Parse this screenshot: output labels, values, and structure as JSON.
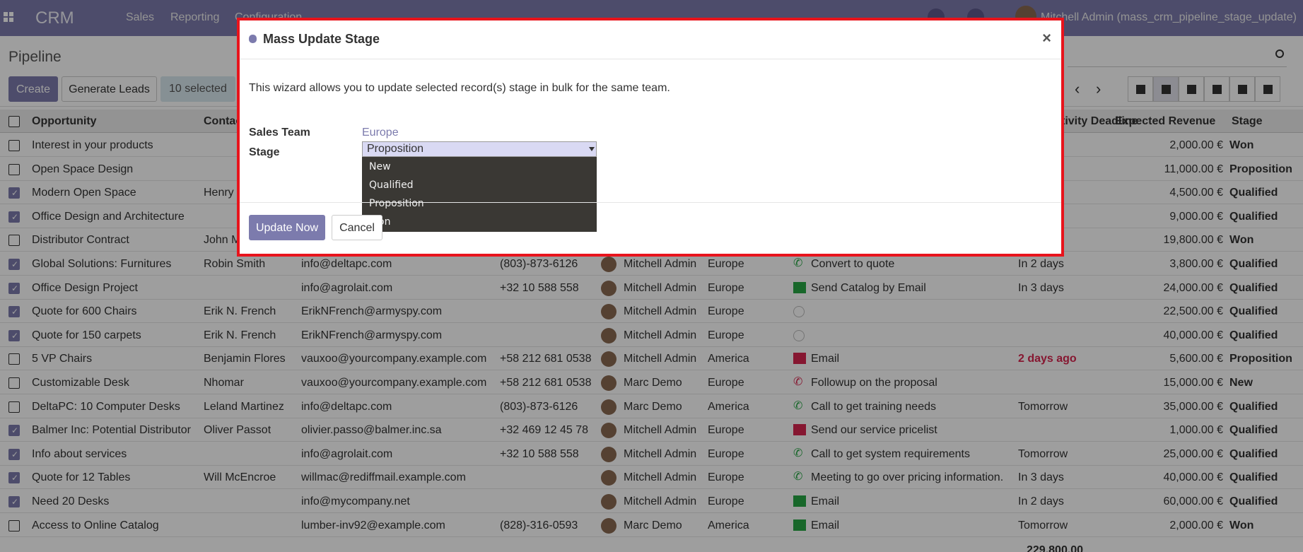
{
  "topbar": {
    "brand": "CRM",
    "menu": [
      "Sales",
      "Reporting",
      "Configuration"
    ],
    "user": "Mitchell Admin (mass_crm_pipeline_stage_update)"
  },
  "control_panel": {
    "breadcrumb": "Pipeline",
    "create_label": "Create",
    "generate_label": "Generate Leads",
    "selected_label": "10 selected"
  },
  "grid": {
    "headers": {
      "opportunity": "Opportunity",
      "contact": "Contact Name",
      "pipeline": "Next Activity Deadline",
      "revenue": "Expected Revenue",
      "stage": "Stage"
    },
    "rows": [
      {
        "checked": false,
        "opportunity": "Interest in your products",
        "contact": "",
        "email": "",
        "phone": "",
        "user": "",
        "team": "",
        "activity": "",
        "activity_type": "",
        "deadline": "",
        "revenue": "2,000.00 €",
        "stage": "Won"
      },
      {
        "checked": false,
        "opportunity": "Open Space Design",
        "contact": "",
        "email": "",
        "phone": "",
        "user": "",
        "team": "",
        "activity": "",
        "activity_type": "",
        "deadline": "",
        "revenue": "11,000.00 €",
        "stage": "Proposition"
      },
      {
        "checked": true,
        "opportunity": "Modern Open Space",
        "contact": "Henry",
        "email": "",
        "phone": "",
        "user": "",
        "team": "",
        "activity": "",
        "activity_type": "",
        "deadline": "",
        "revenue": "4,500.00 €",
        "stage": "Qualified"
      },
      {
        "checked": true,
        "opportunity": "Office Design and Architecture",
        "contact": "",
        "email": "",
        "phone": "",
        "user": "",
        "team": "",
        "activity": "",
        "activity_type": "",
        "deadline": "",
        "revenue": "9,000.00 €",
        "stage": "Qualified"
      },
      {
        "checked": false,
        "opportunity": "Distributor Contract",
        "contact": "John M",
        "email": "",
        "phone": "",
        "user": "",
        "team": "",
        "activity": "",
        "activity_type": "",
        "deadline": "",
        "revenue": "19,800.00 €",
        "stage": "Won"
      },
      {
        "checked": true,
        "opportunity": "Global Solutions: Furnitures",
        "contact": "Robin Smith",
        "email": "info@deltapc.com",
        "phone": "(803)-873-6126",
        "user": "Mitchell Admin",
        "team": "Europe",
        "activity": "Convert to quote",
        "activity_type": "phone",
        "deadline": "In 2 days",
        "revenue": "3,800.00 €",
        "stage": "Qualified"
      },
      {
        "checked": true,
        "opportunity": "Office Design Project",
        "contact": "",
        "email": "info@agrolait.com",
        "phone": "+32 10 588 558",
        "user": "Mitchell Admin",
        "team": "Europe",
        "activity": "Send Catalog by Email",
        "activity_type": "mail",
        "deadline": "In 3 days",
        "revenue": "24,000.00 €",
        "stage": "Qualified"
      },
      {
        "checked": true,
        "opportunity": "Quote for 600 Chairs",
        "contact": "Erik N. French",
        "email": "ErikNFrench@armyspy.com",
        "phone": "",
        "user": "Mitchell Admin",
        "team": "Europe",
        "activity": "",
        "activity_type": "clock",
        "deadline": "",
        "revenue": "22,500.00 €",
        "stage": "Qualified"
      },
      {
        "checked": true,
        "opportunity": "Quote for 150 carpets",
        "contact": "Erik N. French",
        "email": "ErikNFrench@armyspy.com",
        "phone": "",
        "user": "Mitchell Admin",
        "team": "Europe",
        "activity": "",
        "activity_type": "clock",
        "deadline": "",
        "revenue": "40,000.00 €",
        "stage": "Qualified"
      },
      {
        "checked": false,
        "opportunity": "5 VP Chairs",
        "contact": "Benjamin Flores",
        "email": "vauxoo@yourcompany.example.com",
        "phone": "+58 212 681 0538",
        "user": "Mitchell Admin",
        "team": "America",
        "activity": "Email",
        "activity_type": "mail-red",
        "deadline": "2 days ago",
        "revenue": "5,600.00 €",
        "stage": "Proposition"
      },
      {
        "checked": false,
        "opportunity": "Customizable Desk",
        "contact": "Nhomar",
        "email": "vauxoo@yourcompany.example.com",
        "phone": "+58 212 681 0538",
        "user": "Marc Demo",
        "team": "Europe",
        "activity": "Followup on the proposal",
        "activity_type": "phone-red",
        "deadline": "",
        "revenue": "15,000.00 €",
        "stage": "New"
      },
      {
        "checked": false,
        "opportunity": "DeltaPC: 10 Computer Desks",
        "contact": "Leland Martinez",
        "email": "info@deltapc.com",
        "phone": "(803)-873-6126",
        "user": "Marc Demo",
        "team": "America",
        "activity": "Call to get training needs",
        "activity_type": "phone",
        "deadline": "Tomorrow",
        "revenue": "35,000.00 €",
        "stage": "Qualified"
      },
      {
        "checked": true,
        "opportunity": "Balmer Inc: Potential Distributor",
        "contact": "Oliver Passot",
        "email": "olivier.passo@balmer.inc.sa",
        "phone": "+32 469 12 45 78",
        "user": "Mitchell Admin",
        "team": "Europe",
        "activity": "Send our service pricelist",
        "activity_type": "mail-red",
        "deadline": "",
        "revenue": "1,000.00 €",
        "stage": "Qualified"
      },
      {
        "checked": true,
        "opportunity": "Info about services",
        "contact": "",
        "email": "info@agrolait.com",
        "phone": "+32 10 588 558",
        "user": "Mitchell Admin",
        "team": "Europe",
        "activity": "Call to get system requirements",
        "activity_type": "phone",
        "deadline": "Tomorrow",
        "revenue": "25,000.00 €",
        "stage": "Qualified"
      },
      {
        "checked": true,
        "opportunity": "Quote for 12 Tables",
        "contact": "Will McEncroe",
        "email": "willmac@rediffmail.example.com",
        "phone": "",
        "user": "Mitchell Admin",
        "team": "Europe",
        "activity": "Meeting to go over pricing information.",
        "activity_type": "phone",
        "deadline": "In 3 days",
        "revenue": "40,000.00 €",
        "stage": "Qualified"
      },
      {
        "checked": true,
        "opportunity": "Need 20 Desks",
        "contact": "",
        "email": "info@mycompany.net",
        "phone": "",
        "user": "Mitchell Admin",
        "team": "Europe",
        "activity": "Email",
        "activity_type": "mail",
        "deadline": "In 2 days",
        "revenue": "60,000.00 €",
        "stage": "Qualified"
      },
      {
        "checked": false,
        "opportunity": "Access to Online Catalog",
        "contact": "",
        "email": "lumber-inv92@example.com",
        "phone": "(828)-316-0593",
        "user": "Marc Demo",
        "team": "America",
        "activity": "Email",
        "activity_type": "mail",
        "deadline": "Tomorrow",
        "revenue": "2,000.00 €",
        "stage": "Won"
      }
    ],
    "total": "229,800.00"
  },
  "modal": {
    "title": "Mass Update Stage",
    "description": "This wizard allows you to update selected record(s) stage in bulk for the same team.",
    "team_label": "Sales Team",
    "team_value": "Europe",
    "stage_label": "Stage",
    "stage_value": "Proposition",
    "options": [
      "New",
      "Qualified",
      "Proposition",
      "Won"
    ],
    "update_label": "Update Now",
    "cancel_label": "Cancel"
  }
}
